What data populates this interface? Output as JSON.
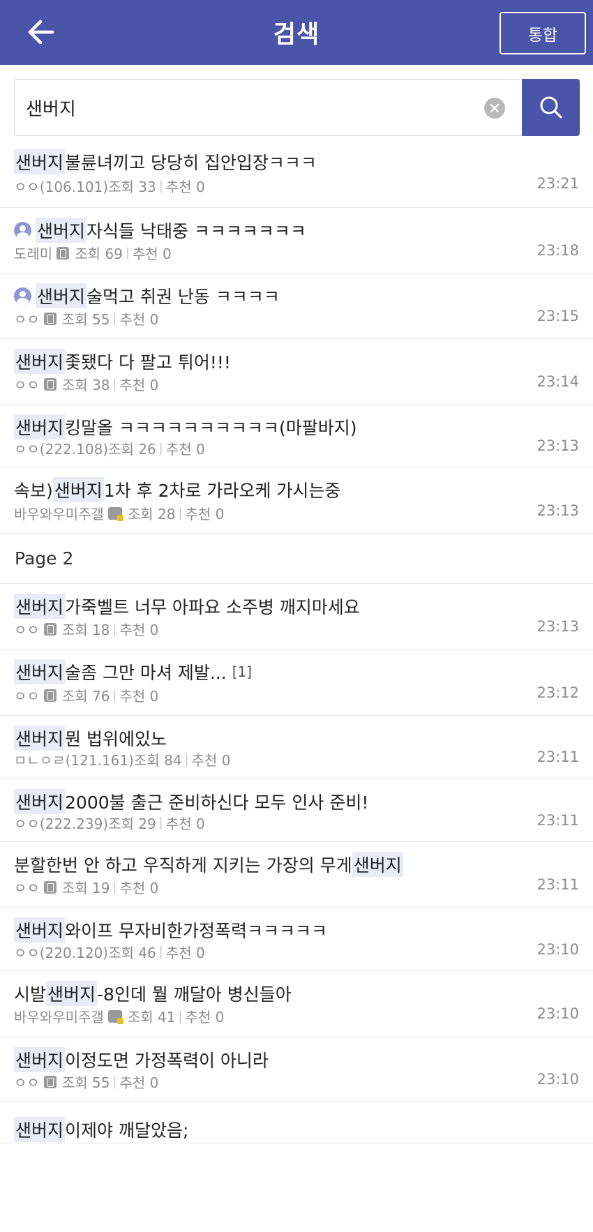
{
  "header": {
    "title": "검색",
    "integrated_label": "통합"
  },
  "search": {
    "value": "샌버지"
  },
  "page_label": "Page 2",
  "posts": [
    {
      "prefix": "",
      "highlight": "샌버지",
      "rest": " 불륜녀끼고 당당히 집안입장ㅋㅋㅋ",
      "comments": "",
      "author": "ㅇㅇ(106.101)",
      "author_icon": "none",
      "views": "조회 33",
      "recommend": "추천 0",
      "time": "23:21",
      "user_icon": false
    },
    {
      "prefix": "",
      "highlight": "샌버지",
      "rest": " 자식들 낙태중 ㅋㅋㅋㅋㅋㅋㅋ",
      "comments": "",
      "author": "도레미",
      "author_icon": "mobile",
      "views": "조회 69",
      "recommend": "추천 0",
      "time": "23:18",
      "user_icon": true
    },
    {
      "prefix": "",
      "highlight": "샌버지",
      "rest": " 술먹고 취권 난동 ㅋㅋㅋㅋ",
      "comments": "",
      "author": "ㅇㅇ",
      "author_icon": "mobile",
      "views": "조회 55",
      "recommend": "추천 0",
      "time": "23:15",
      "user_icon": true
    },
    {
      "prefix": "",
      "highlight": "샌버지",
      "rest": " 좇됐다 다 팔고 튀어!!!",
      "comments": "",
      "author": "ㅇㅇ",
      "author_icon": "mobile",
      "views": "조회 38",
      "recommend": "추천 0",
      "time": "23:14",
      "user_icon": false
    },
    {
      "prefix": "",
      "highlight": "샌버지",
      "rest": " 킹말올 ㅋㅋㅋㅋㅋㅋㅋㅋㅋㅋ(마팔바지)",
      "comments": "",
      "author": "ㅇㅇ(222.108)",
      "author_icon": "none",
      "views": "조회 26",
      "recommend": "추천 0",
      "time": "23:13",
      "user_icon": false
    },
    {
      "prefix": "속보) ",
      "highlight": "샌버지",
      "rest": " 1차 후 2차로 가라오케 가시는중",
      "comments": "",
      "author": "바우와우미주갤",
      "author_icon": "fixed",
      "views": "조회 28",
      "recommend": "추천 0",
      "time": "23:13",
      "user_icon": false
    }
  ],
  "posts_page2": [
    {
      "prefix": "",
      "highlight": "샌버지",
      "rest": " 가죽벨트 너무 아파요 소주병 깨지마세요",
      "comments": "",
      "author": "ㅇㅇ",
      "author_icon": "mobile",
      "views": "조회 18",
      "recommend": "추천 0",
      "time": "23:13",
      "user_icon": false
    },
    {
      "prefix": "",
      "highlight": "샌버지",
      "rest": " 술좀 그만 마셔 제발...",
      "comments": "[1]",
      "author": "ㅇㅇ",
      "author_icon": "mobile",
      "views": "조회 76",
      "recommend": "추천 0",
      "time": "23:12",
      "user_icon": false
    },
    {
      "prefix": "",
      "highlight": "샌버지",
      "rest": " 뭔 법위에있노",
      "comments": "",
      "author": "ㅁㄴㅇㄹ(121.161)",
      "author_icon": "none",
      "views": "조회 84",
      "recommend": "추천 0",
      "time": "23:11",
      "user_icon": false
    },
    {
      "prefix": "",
      "highlight": "샌버지",
      "rest": " 2000불 출근 준비하신다 모두 인사 준비!",
      "comments": "",
      "author": "ㅇㅇ(222.239)",
      "author_icon": "none",
      "views": "조회 29",
      "recommend": "추천 0",
      "time": "23:11",
      "user_icon": false
    },
    {
      "prefix": "분할한번 안 하고 우직하게 지키는 가장의 무게 ",
      "highlight": "샌버지",
      "rest": "",
      "comments": "",
      "author": "ㅇㅇ",
      "author_icon": "mobile",
      "views": "조회 19",
      "recommend": "추천 0",
      "time": "23:11",
      "user_icon": false
    },
    {
      "prefix": "",
      "highlight": "샌버지",
      "rest": " 와이프 무자비한가정폭력ㅋㅋㅋㅋㅋ",
      "comments": "",
      "author": "ㅇㅇ(220.120)",
      "author_icon": "none",
      "views": "조회 46",
      "recommend": "추천 0",
      "time": "23:10",
      "user_icon": false
    },
    {
      "prefix": "시발 ",
      "highlight": "샌버지",
      "rest": " -8인데 뭘 깨달아 병신들아",
      "comments": "",
      "author": "바우와우미주갤",
      "author_icon": "fixed",
      "views": "조회 41",
      "recommend": "추천 0",
      "time": "23:10",
      "user_icon": false
    },
    {
      "prefix": "",
      "highlight": "샌버지",
      "rest": " 이정도면 가정폭력이 아니라",
      "comments": "",
      "author": "ㅇㅇ",
      "author_icon": "mobile",
      "views": "조회 55",
      "recommend": "추천 0",
      "time": "23:10",
      "user_icon": false
    },
    {
      "prefix": "",
      "highlight": "샌버지",
      "rest": " 이제야 깨달았음;",
      "comments": "",
      "author": "",
      "author_icon": "none",
      "views": "",
      "recommend": "",
      "time": "",
      "user_icon": false
    }
  ],
  "colors": {
    "header_bg": "#4a55a9",
    "highlight_bg": "#e9ebf7",
    "meta_text": "#8c8c8c"
  }
}
